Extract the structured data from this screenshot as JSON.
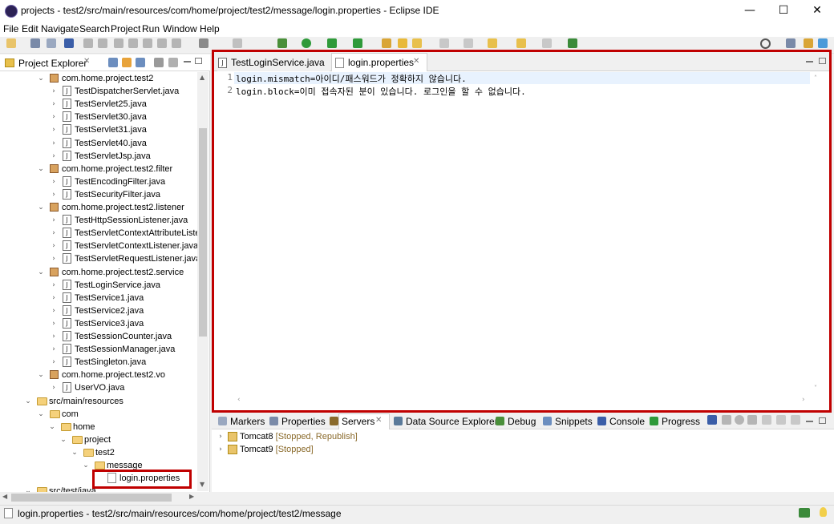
{
  "window": {
    "title": "projects - test2/src/main/resources/com/home/project/test2/message/login.properties - Eclipse IDE",
    "minimize": "—",
    "maximize": "☐",
    "close": "✕"
  },
  "menu": [
    "File",
    "Edit",
    "Navigate",
    "Search",
    "Project",
    "Run",
    "Window",
    "Help"
  ],
  "explorer": {
    "title": "Project Explorer",
    "close": "✕",
    "tree": [
      {
        "label": "com.home.project.test2",
        "type": "package"
      },
      {
        "label": "TestDispatcherServlet.java",
        "type": "java"
      },
      {
        "label": "TestServlet25.java",
        "type": "java"
      },
      {
        "label": "TestServlet30.java",
        "type": "java"
      },
      {
        "label": "TestServlet31.java",
        "type": "java"
      },
      {
        "label": "TestServlet40.java",
        "type": "java"
      },
      {
        "label": "TestServletJsp.java",
        "type": "java"
      },
      {
        "label": "com.home.project.test2.filter",
        "type": "package"
      },
      {
        "label": "TestEncodingFilter.java",
        "type": "java"
      },
      {
        "label": "TestSecurityFilter.java",
        "type": "java"
      },
      {
        "label": "com.home.project.test2.listener",
        "type": "package"
      },
      {
        "label": "TestHttpSessionListener.java",
        "type": "java"
      },
      {
        "label": "TestServletContextAttributeListe",
        "type": "java"
      },
      {
        "label": "TestServletContextListener.java",
        "type": "java"
      },
      {
        "label": "TestServletRequestListener.java",
        "type": "java"
      },
      {
        "label": "com.home.project.test2.service",
        "type": "package"
      },
      {
        "label": "TestLoginService.java",
        "type": "java"
      },
      {
        "label": "TestService1.java",
        "type": "java"
      },
      {
        "label": "TestService2.java",
        "type": "java"
      },
      {
        "label": "TestService3.java",
        "type": "java"
      },
      {
        "label": "TestSessionCounter.java",
        "type": "java"
      },
      {
        "label": "TestSessionManager.java",
        "type": "java"
      },
      {
        "label": "TestSingleton.java",
        "type": "java"
      },
      {
        "label": "com.home.project.test2.vo",
        "type": "package"
      },
      {
        "label": "UserVO.java",
        "type": "java"
      },
      {
        "label": "src/main/resources",
        "type": "srcfolder"
      },
      {
        "label": "com",
        "type": "folder"
      },
      {
        "label": "home",
        "type": "folder"
      },
      {
        "label": "project",
        "type": "folder"
      },
      {
        "label": "test2",
        "type": "folder"
      },
      {
        "label": "message",
        "type": "folder"
      },
      {
        "label": "login.properties",
        "type": "file"
      },
      {
        "label": "src/test/java",
        "type": "srcfolder"
      }
    ]
  },
  "editor": {
    "tabs": [
      {
        "label": "TestLoginService.java",
        "active": false
      },
      {
        "label": "login.properties",
        "active": true
      }
    ],
    "tab_close": "✕",
    "lines": [
      {
        "num": "1",
        "key": "login.mismatch",
        "value": "=아이디/패스워드가 정확하지 않습니다."
      },
      {
        "num": "2",
        "key": "login.block",
        "value": "=이미 접속자된 분이 있습니다. 로그인을 할 수 없습니다."
      }
    ]
  },
  "bottom_panel": {
    "tabs": [
      "Markers",
      "Properties",
      "Servers",
      "Data Source Explorer",
      "Debug",
      "Snippets",
      "Console",
      "Progress"
    ],
    "servers": [
      {
        "name": "Tomcat8",
        "status": "[Stopped, Republish]"
      },
      {
        "name": "Tomcat9",
        "status": "[Stopped]"
      }
    ]
  },
  "statusbar": {
    "text": "login.properties - test2/src/main/resources/com/home/project/test2/message"
  },
  "colors": {
    "highlight": "#c00000",
    "status_text": "#8a6a2b",
    "current_line": "#e8f2fe"
  }
}
